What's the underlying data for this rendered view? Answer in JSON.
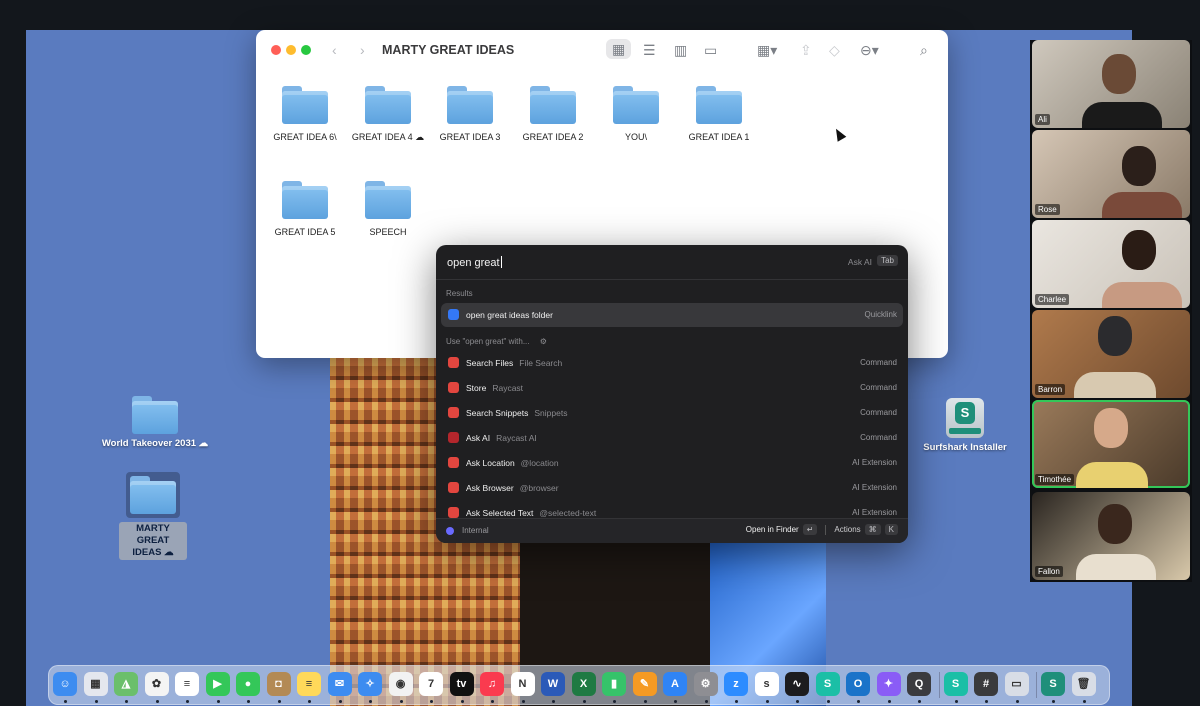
{
  "finder": {
    "title": "MARTY GREAT IDEAS",
    "items": [
      {
        "name": "GREAT IDEA 6\\"
      },
      {
        "name": "GREAT IDEA 4 ☁"
      },
      {
        "name": "GREAT IDEA 3"
      },
      {
        "name": "GREAT IDEA 2"
      },
      {
        "name": "YOU\\"
      },
      {
        "name": "GREAT IDEA 1"
      },
      {
        "name": "GREAT IDEA 5"
      },
      {
        "name": "SPEECH"
      }
    ]
  },
  "desktop": {
    "icons": [
      {
        "label": "World Takeover 2031 ☁"
      },
      {
        "label": "MARTY GREAT IDEAS ☁"
      },
      {
        "label": "Surfshark Installer"
      }
    ]
  },
  "raycast": {
    "query": "open great",
    "ask_ai": "Ask AI",
    "tab_key": "Tab",
    "results_header": "Results",
    "use_header": "Use \"open great\" with...",
    "results": [
      {
        "title": "open great ideas folder",
        "subtitle": "",
        "kind": "Quicklink",
        "color": "#3478f6"
      }
    ],
    "commands": [
      {
        "title": "Search Files",
        "subtitle": "File Search",
        "kind": "Command",
        "color": "#e2463f"
      },
      {
        "title": "Store",
        "subtitle": "Raycast",
        "kind": "Command",
        "color": "#e2463f"
      },
      {
        "title": "Search Snippets",
        "subtitle": "Snippets",
        "kind": "Command",
        "color": "#e2463f"
      },
      {
        "title": "Ask AI",
        "subtitle": "Raycast AI",
        "kind": "Command",
        "color": "#e2463f"
      },
      {
        "title": "Ask Location",
        "subtitle": "@location",
        "kind": "AI Extension",
        "color": "#e2463f"
      },
      {
        "title": "Ask Browser",
        "subtitle": "@browser",
        "kind": "AI Extension",
        "color": "#e2463f"
      },
      {
        "title": "Ask Selected Text",
        "subtitle": "@selected-text",
        "kind": "AI Extension",
        "color": "#e2463f"
      }
    ],
    "footer": {
      "left": "Internal",
      "primary_action": "Open in Finder",
      "return_key": "↵",
      "actions_label": "Actions",
      "cmd_key": "⌘",
      "k_key": "K"
    }
  },
  "participants": [
    {
      "name": "Ali"
    },
    {
      "name": "Rose"
    },
    {
      "name": "Charlee"
    },
    {
      "name": "Barron"
    },
    {
      "name": "Timothée"
    },
    {
      "name": "Fallon"
    }
  ],
  "dock": {
    "apps": [
      {
        "icon": "finder-icon",
        "color": "#3d8cf0",
        "glyph": "☺"
      },
      {
        "icon": "launchpad-icon",
        "color": "#e4e7ee",
        "glyph": "▦"
      },
      {
        "icon": "maps-icon",
        "color": "#6bbf6b",
        "glyph": "◮"
      },
      {
        "icon": "photos-icon",
        "color": "#f4f4f4",
        "glyph": "✿"
      },
      {
        "icon": "reminders-icon",
        "color": "#ffffff",
        "glyph": "≡"
      },
      {
        "icon": "facetime-icon",
        "color": "#34c759",
        "glyph": "▶"
      },
      {
        "icon": "messages-icon",
        "color": "#34c759",
        "glyph": "●"
      },
      {
        "icon": "contacts-icon",
        "color": "#b38a55",
        "glyph": "◘"
      },
      {
        "icon": "notes-icon",
        "color": "#ffd95a",
        "glyph": "≡"
      },
      {
        "icon": "mail-icon",
        "color": "#3d8cf0",
        "glyph": "✉"
      },
      {
        "icon": "safari-icon",
        "color": "#3d8cf0",
        "glyph": "✧"
      },
      {
        "icon": "chrome-icon",
        "color": "#f2f2f2",
        "glyph": "◉"
      },
      {
        "icon": "calendar-icon",
        "color": "#ffffff",
        "glyph": "7"
      },
      {
        "icon": "appletv-icon",
        "color": "#111111",
        "glyph": "tv"
      },
      {
        "icon": "music-icon",
        "color": "#fa3b4f",
        "glyph": "♫"
      },
      {
        "icon": "news-icon",
        "color": "#ffffff",
        "glyph": "N"
      },
      {
        "icon": "word-icon",
        "color": "#2b5ab8",
        "glyph": "W"
      },
      {
        "icon": "excel-icon",
        "color": "#1f7a43",
        "glyph": "X"
      },
      {
        "icon": "numbers-icon",
        "color": "#36c36a",
        "glyph": "▮"
      },
      {
        "icon": "pages-icon",
        "color": "#f59a23",
        "glyph": "✎"
      },
      {
        "icon": "appstore-icon",
        "color": "#2f84f5",
        "glyph": "A"
      },
      {
        "icon": "settings-icon",
        "color": "#8e8e93",
        "glyph": "⚙"
      },
      {
        "icon": "zoom-icon",
        "color": "#2d8cff",
        "glyph": "z"
      },
      {
        "icon": "sky-icon",
        "color": "#ffffff",
        "glyph": "s"
      },
      {
        "icon": "stocks-icon",
        "color": "#1c1c1e",
        "glyph": "∿"
      },
      {
        "icon": "surfshark-icon",
        "color": "#1bbfa6",
        "glyph": "S"
      },
      {
        "icon": "outlook-icon",
        "color": "#1a73c9",
        "glyph": "O"
      },
      {
        "icon": "copilot-icon",
        "color": "#8a5cf6",
        "glyph": "✦"
      },
      {
        "icon": "quicktime-icon",
        "color": "#3b3b3f",
        "glyph": "Q"
      },
      {
        "icon": "surfshark-icon-2",
        "color": "#1bbfa6",
        "glyph": "S"
      },
      {
        "icon": "calculator-icon",
        "color": "#3a3a3c",
        "glyph": "#"
      },
      {
        "icon": "printer-icon",
        "color": "#d8dde6",
        "glyph": "▭"
      },
      {
        "icon": "surfshark-installer-icon",
        "color": "#1f8f7a",
        "glyph": "S"
      },
      {
        "icon": "trash-icon",
        "color": "#d8dde6",
        "glyph": "🗑"
      }
    ]
  }
}
